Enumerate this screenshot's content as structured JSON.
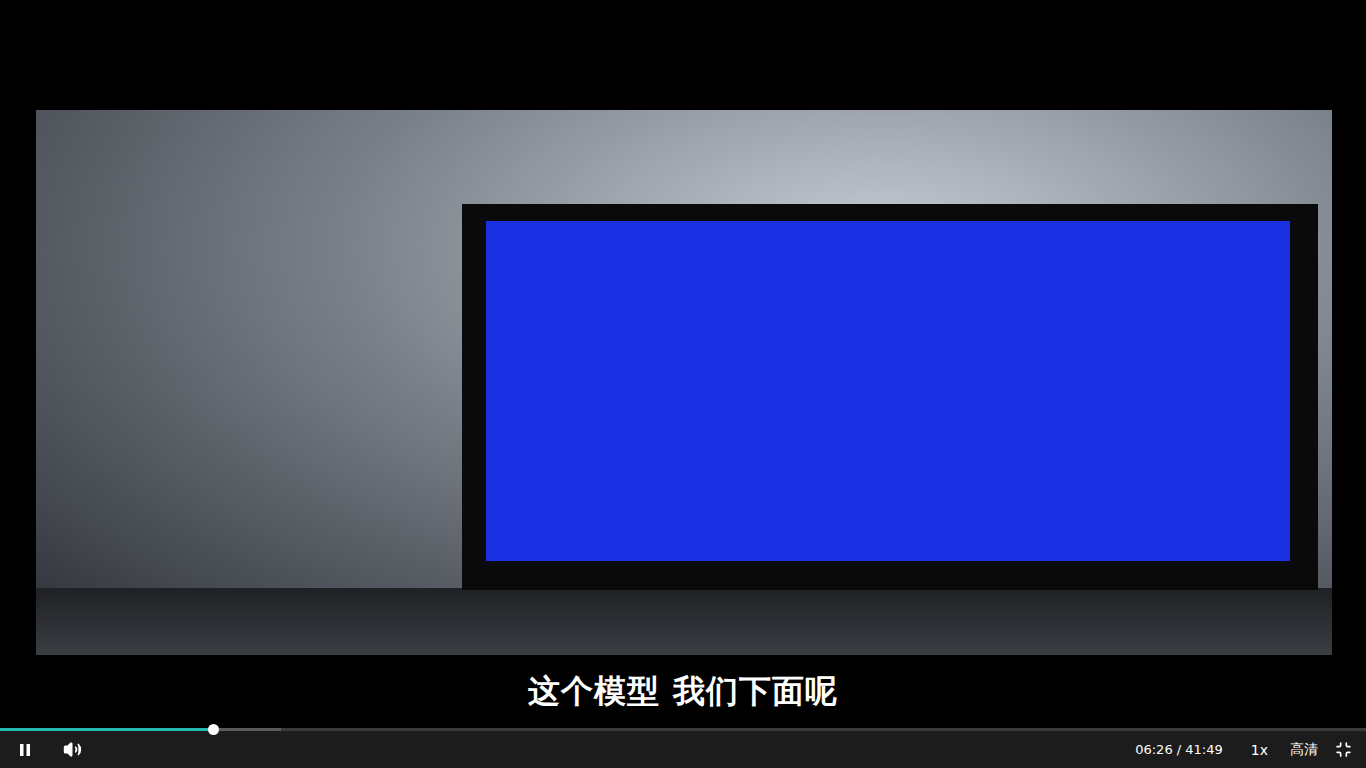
{
  "player": {
    "caption": "这个模型 我们下面呢",
    "playing": true,
    "muted": false,
    "progress": {
      "level": 0.156,
      "buffered": 0.206
    },
    "time": {
      "current": "06:26",
      "separator": "/",
      "total": "41:49"
    },
    "speed": "1x",
    "quality": "高清",
    "fullscreen": true
  }
}
